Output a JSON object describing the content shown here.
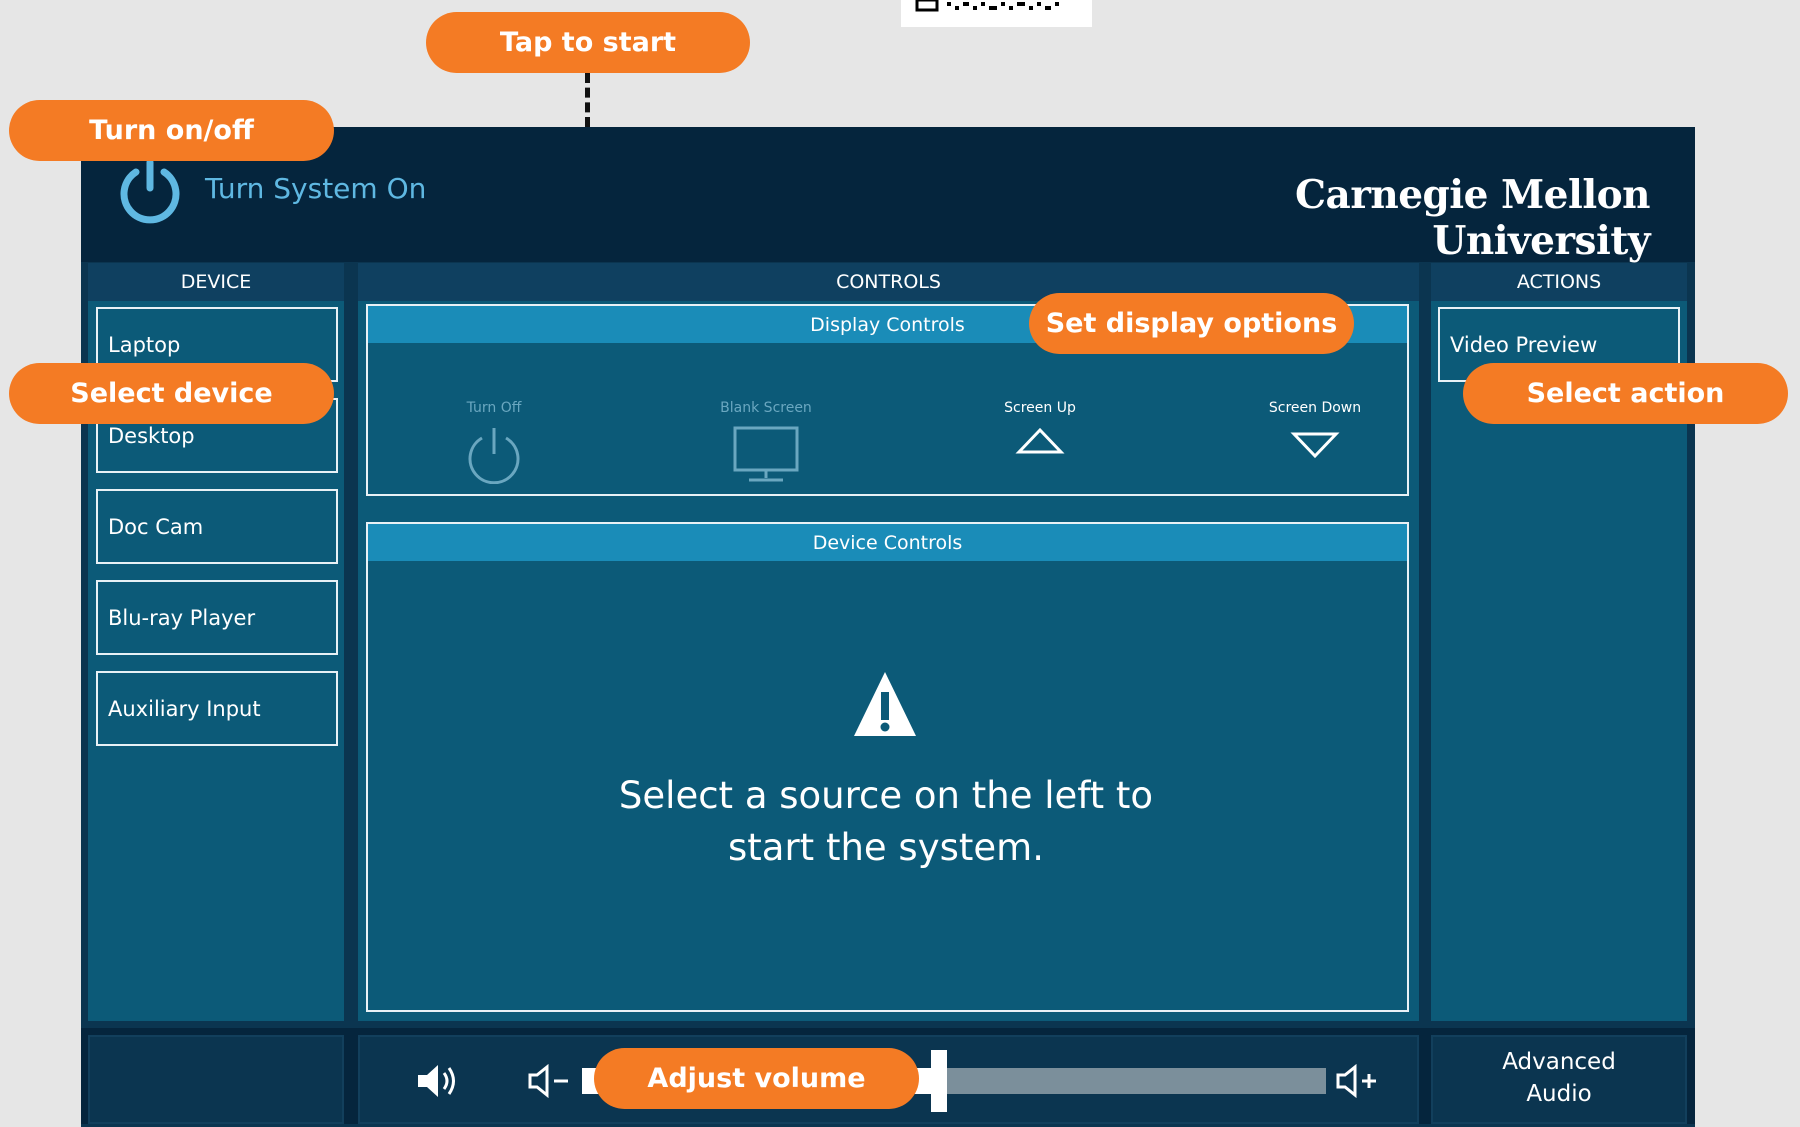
{
  "header": {
    "system_label": "Turn System On",
    "brand": "Carnegie Mellon University"
  },
  "columns": {
    "device": "DEVICE",
    "controls": "CONTROLS",
    "actions": "ACTIONS"
  },
  "sources": [
    "Laptop",
    "Desktop",
    "Doc Cam",
    "Blu-ray Player",
    "Auxiliary Input"
  ],
  "display_controls": {
    "title": "Display Controls",
    "turn_off": "Turn Off",
    "blank_screen": "Blank Screen",
    "screen_up": "Screen Up",
    "screen_down": "Screen Down"
  },
  "device_controls": {
    "title": "Device Controls",
    "message_line1": "Select a source on the left to",
    "message_line2": "start the system."
  },
  "actions": {
    "video_preview": "Video Preview"
  },
  "audio": {
    "advanced_line1": "Advanced",
    "advanced_line2": "Audio",
    "volume_fraction": 0.48
  },
  "callouts": {
    "tap_to_start": "Tap to start",
    "turn_on_off": "Turn on/off",
    "select_device": "Select device",
    "set_display": "Set display options",
    "select_action": "Select action",
    "adjust_volume": "Adjust volume"
  },
  "colors": {
    "callout": "#f47b24",
    "panel": "#0b3550",
    "header": "#05253d",
    "column": "#0c5a78",
    "group_header": "#1a8cb8",
    "power_icon": "#5fb8e2"
  },
  "icons": {
    "power": "power-icon",
    "monitor": "monitor-icon",
    "up": "triangle-up-icon",
    "down": "triangle-down-icon",
    "warning": "warning-icon",
    "speaker": "speaker-icon",
    "volume_down": "volume-down-icon",
    "volume_up": "volume-up-icon"
  }
}
